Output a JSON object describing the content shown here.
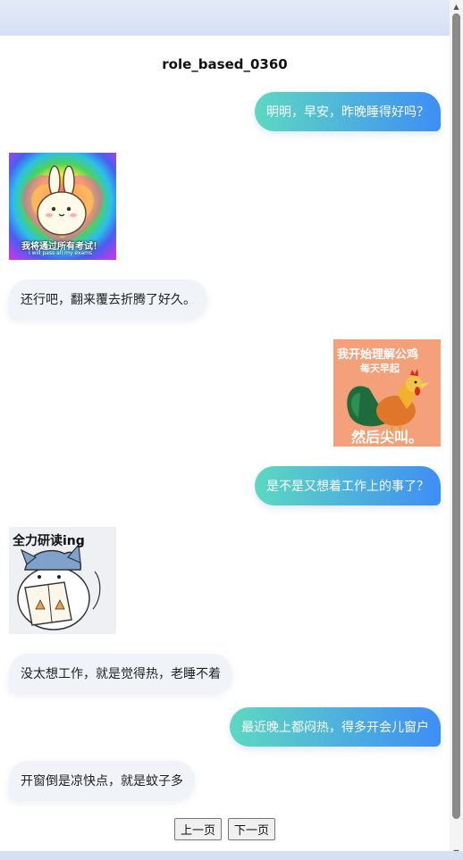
{
  "page": {
    "title": "role_based_0360"
  },
  "messages": [
    {
      "side": "right",
      "type": "text",
      "text": "明明，早安，昨晚睡得好吗？"
    },
    {
      "side": "left",
      "type": "sticker",
      "sticker": "bunny-rainbow-heart",
      "caption_cn": "我将通过所有考试！",
      "caption_en": "I will pass all my exams"
    },
    {
      "side": "left",
      "type": "text",
      "text": "还行吧，翻来覆去折腾了好久。"
    },
    {
      "side": "right",
      "type": "sticker",
      "sticker": "rooster-screaming",
      "caption_top": "我开始理解公鸡",
      "caption_mid": "每天早起",
      "caption_bottom": "然后尖叫。"
    },
    {
      "side": "right",
      "type": "text",
      "text": "是不是又想着工作上的事了？"
    },
    {
      "side": "left",
      "type": "sticker",
      "sticker": "cat-reading-book",
      "caption_top": "全力研读ing"
    },
    {
      "side": "left",
      "type": "text",
      "text": "没太想工作，就是觉得热，老睡不着"
    },
    {
      "side": "right",
      "type": "text",
      "text": "最近晚上都闷热，得多开会儿窗户"
    },
    {
      "side": "left",
      "type": "text",
      "text": "开窗倒是凉快点，就是蚊子多"
    }
  ],
  "pager": {
    "prev_label": "上一页",
    "next_label": "下一页"
  },
  "colors": {
    "bubble_right_start": "#5dd8c1",
    "bubble_right_end": "#3f8ef5",
    "bubble_left": "#f0f3f8"
  }
}
